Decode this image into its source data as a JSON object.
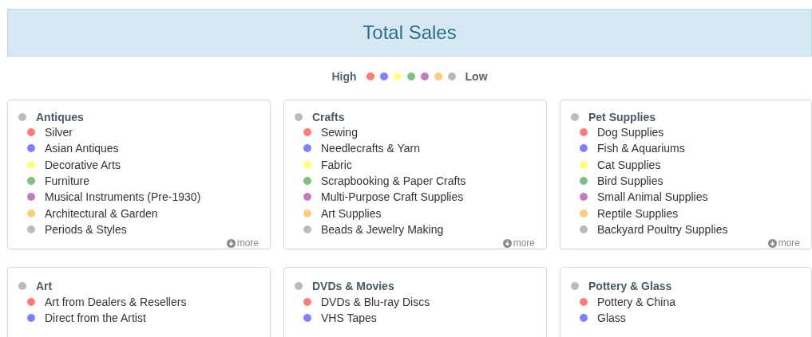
{
  "title": "Total Sales",
  "legend": {
    "high_label": "High",
    "low_label": "Low",
    "dots": [
      {
        "color": "#ff7b7b"
      },
      {
        "color": "#7f7fff"
      },
      {
        "color": "#ffff7f"
      },
      {
        "color": "#7fbf7f"
      },
      {
        "color": "#bf7fbf"
      },
      {
        "color": "#ffcc77"
      },
      {
        "color": "#bbbbbb"
      }
    ]
  },
  "categories": [
    {
      "name": "Antiques",
      "color": "#bbbbbb",
      "more_label": "more",
      "items": [
        {
          "name": "Silver",
          "color": "#ff7b7b"
        },
        {
          "name": "Asian Antiques",
          "color": "#7f7fff"
        },
        {
          "name": "Decorative Arts",
          "color": "#ffff7f"
        },
        {
          "name": "Furniture",
          "color": "#7fbf7f"
        },
        {
          "name": "Musical Instruments (Pre-1930)",
          "color": "#bf7fbf"
        },
        {
          "name": "Architectural & Garden",
          "color": "#ffcc77"
        },
        {
          "name": "Periods & Styles",
          "color": "#bbbbbb"
        }
      ]
    },
    {
      "name": "Crafts",
      "color": "#bbbbbb",
      "more_label": "more",
      "items": [
        {
          "name": "Sewing",
          "color": "#ff7b7b"
        },
        {
          "name": "Needlecrafts & Yarn",
          "color": "#7f7fff"
        },
        {
          "name": "Fabric",
          "color": "#ffff7f"
        },
        {
          "name": "Scrapbooking & Paper Crafts",
          "color": "#7fbf7f"
        },
        {
          "name": "Multi-Purpose Craft Supplies",
          "color": "#bf7fbf"
        },
        {
          "name": "Art Supplies",
          "color": "#ffcc77"
        },
        {
          "name": "Beads & Jewelry Making",
          "color": "#bbbbbb"
        }
      ]
    },
    {
      "name": "Pet Supplies",
      "color": "#bbbbbb",
      "more_label": "more",
      "items": [
        {
          "name": "Dog Supplies",
          "color": "#ff7b7b"
        },
        {
          "name": "Fish & Aquariums",
          "color": "#7f7fff"
        },
        {
          "name": "Cat Supplies",
          "color": "#ffff7f"
        },
        {
          "name": "Bird Supplies",
          "color": "#7fbf7f"
        },
        {
          "name": "Small Animal Supplies",
          "color": "#bf7fbf"
        },
        {
          "name": "Reptile Supplies",
          "color": "#ffcc77"
        },
        {
          "name": "Backyard Poultry Supplies",
          "color": "#bbbbbb"
        }
      ]
    },
    {
      "name": "Art",
      "color": "#bbbbbb",
      "items": [
        {
          "name": "Art from Dealers & Resellers",
          "color": "#ff7b7b"
        },
        {
          "name": "Direct from the Artist",
          "color": "#7f7fff"
        }
      ]
    },
    {
      "name": "DVDs & Movies",
      "color": "#bbbbbb",
      "items": [
        {
          "name": "DVDs & Blu-ray Discs",
          "color": "#ff7b7b"
        },
        {
          "name": "VHS Tapes",
          "color": "#7f7fff"
        }
      ]
    },
    {
      "name": "Pottery & Glass",
      "color": "#bbbbbb",
      "items": [
        {
          "name": "Pottery & China",
          "color": "#ff7b7b"
        },
        {
          "name": "Glass",
          "color": "#7f7fff"
        }
      ]
    }
  ]
}
